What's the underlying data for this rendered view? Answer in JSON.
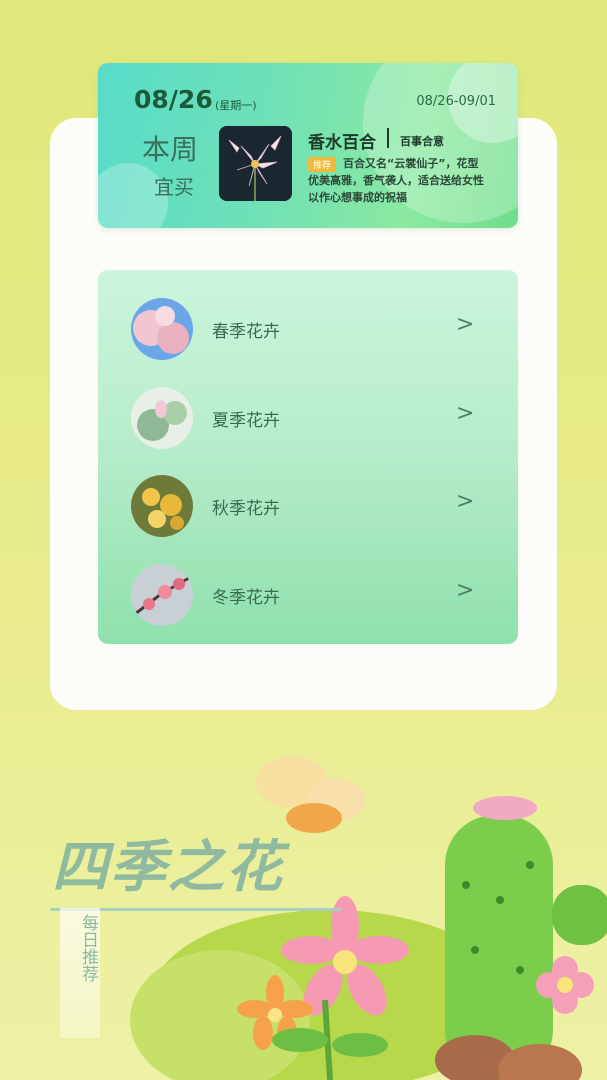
{
  "weekly": {
    "date": "08/26",
    "weekday": "(星期一)",
    "range": "08/26-09/01",
    "title_line1": "本周",
    "title_line2": "宜买",
    "flower_name": "香水百合",
    "flower_tag": "百事合意",
    "badge": "推荐",
    "description": "百合又名“云裳仙子”，花型优美高雅，香气袭人，适合送给女性以作心想事成的祝福"
  },
  "seasons": [
    {
      "label": "春季花卉",
      "arrow": ">"
    },
    {
      "label": "夏季花卉",
      "arrow": ">"
    },
    {
      "label": "秋季花卉",
      "arrow": ">"
    },
    {
      "label": "冬季花卉",
      "arrow": ">"
    }
  ],
  "decor": {
    "title": "四季之花",
    "ribbon": "每日推荐"
  },
  "colors": {
    "accent_green": "#6fe0b7",
    "badge_yellow": "#f2b93a",
    "background": "#e3ea82"
  }
}
